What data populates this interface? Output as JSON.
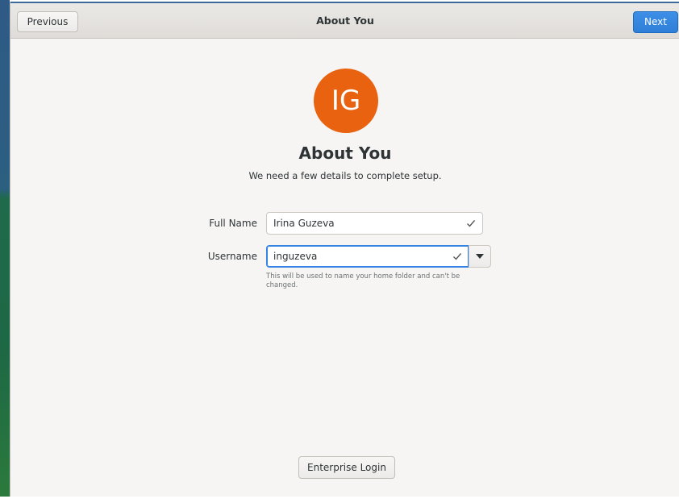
{
  "header": {
    "title": "About You",
    "previous_label": "Previous",
    "next_label": "Next"
  },
  "avatar": {
    "initials": "IG",
    "color": "#e8620f"
  },
  "page": {
    "title": "About You",
    "subtitle": "We need a few details to complete setup."
  },
  "form": {
    "full_name": {
      "label": "Full Name",
      "value": "Irina Guzeva",
      "valid": true
    },
    "username": {
      "label": "Username",
      "value": "inguzeva",
      "valid": true,
      "hint": "This will be used to name your home folder and can't be changed."
    }
  },
  "footer": {
    "enterprise_login_label": "Enterprise Login"
  },
  "colors": {
    "accent": "#3584e4",
    "check": "#555753"
  }
}
